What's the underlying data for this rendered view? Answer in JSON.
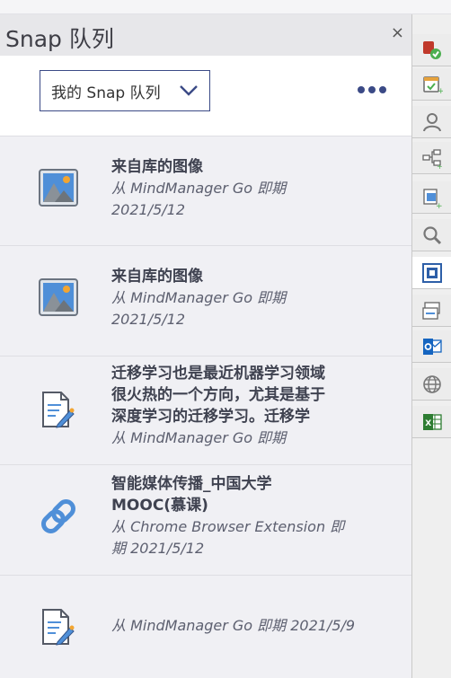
{
  "panel": {
    "title": "Snap 队列",
    "close_label": "×"
  },
  "toolbar": {
    "queue_selector": "我的 Snap 队列"
  },
  "items": [
    {
      "icon": "image-icon",
      "title": "来自库的图像",
      "source": "从 MindManager Go 即期",
      "date": "2021/5/12"
    },
    {
      "icon": "image-icon",
      "title": "来自库的图像",
      "source": "从 MindManager Go 即期",
      "date": "2021/5/12"
    },
    {
      "icon": "note-icon",
      "title_lines": [
        "迁移学习也是最近机器学习领域",
        "很火热的一个方向，尤其是基于",
        "深度学习的迁移学习。迁移学"
      ],
      "source": "从 MindManager Go 即期"
    },
    {
      "icon": "link-icon",
      "title_lines": [
        "智能媒体传播_中国大学",
        "MOOC(慕课)"
      ],
      "source_lines": [
        "从 Chrome Browser Extension 即",
        "期 2021/5/12"
      ]
    },
    {
      "icon": "note-icon",
      "source": "从 MindManager Go 即期 2021/5/9"
    }
  ],
  "sidebar": {
    "tools": [
      "task-check-icon",
      "calendar-add-icon",
      "person-icon",
      "map-nodes-icon",
      "topic-add-icon",
      "search-icon",
      "snap-icon",
      "window-icon",
      "outlook-icon",
      "globe-icon",
      "excel-icon"
    ],
    "active": "snap-icon"
  },
  "colors": {
    "accent": "#3b4a86",
    "panel_bg": "#f0f0f4",
    "header_bg": "#e7e7ea"
  }
}
